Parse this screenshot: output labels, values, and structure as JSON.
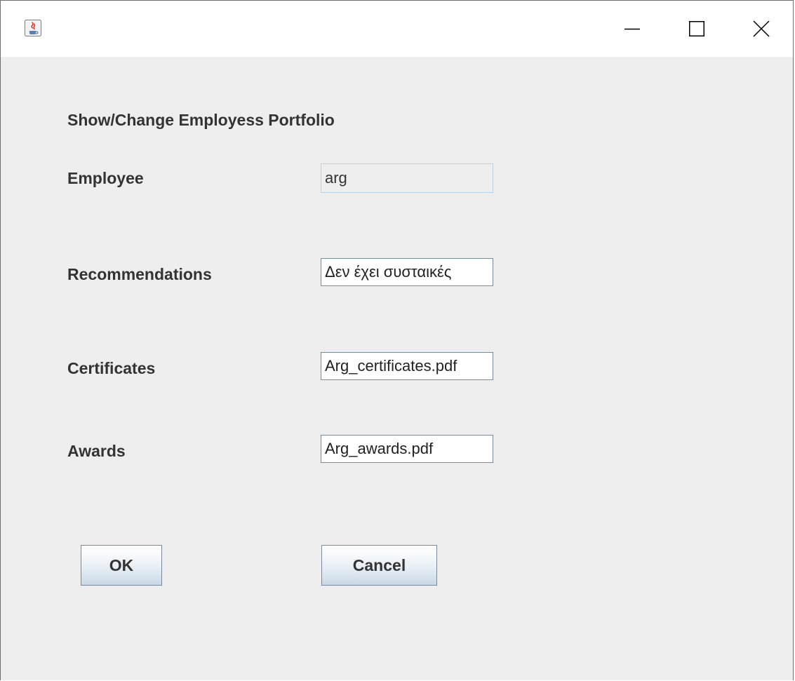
{
  "titlebar": {
    "app_icon": "java-cup-icon",
    "minimize_icon": "minimize-icon",
    "maximize_icon": "maximize-icon",
    "close_icon": "close-icon"
  },
  "form": {
    "heading": "Show/Change Employess Portfolio",
    "employee": {
      "label": "Employee",
      "value": "arg"
    },
    "recommendations": {
      "label": "Recommendations",
      "value": "Δεν έχει συσταικές"
    },
    "certificates": {
      "label": "Certificates",
      "value": "Arg_certificates.pdf"
    },
    "awards": {
      "label": "Awards",
      "value": "Arg_awards.pdf"
    }
  },
  "buttons": {
    "ok_label": "OK",
    "cancel_label": "Cancel"
  },
  "colors": {
    "window_background": "#eeeeee",
    "titlebar_background": "#ffffff",
    "readonly_field_border": "#b8cfe5",
    "field_border": "#7a8a99"
  }
}
